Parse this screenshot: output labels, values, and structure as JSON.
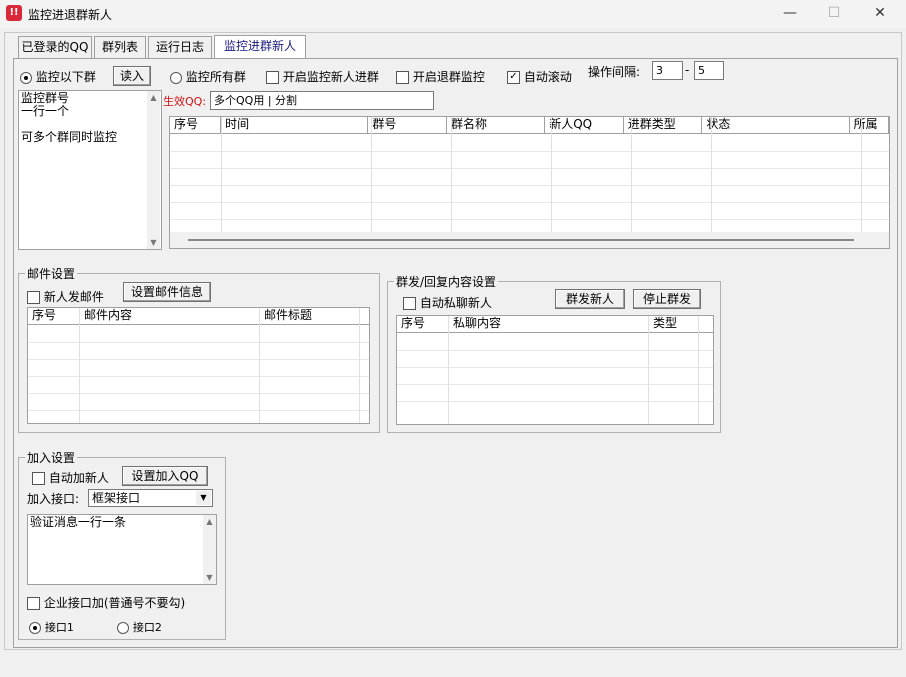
{
  "window": {
    "title": "监控进退群新人",
    "min": "—",
    "max": "☐",
    "close": "✕"
  },
  "tabs": [
    {
      "label": "已登录的QQ"
    },
    {
      "label": "群列表"
    },
    {
      "label": "运行日志"
    },
    {
      "label": "监控进群新人"
    }
  ],
  "top": {
    "monitor_following": "监控以下群",
    "read_btn": "读入",
    "monitor_all": "监控所有群",
    "enable_join": "开启监控新人进群",
    "enable_leave": "开启退群监控",
    "auto_scroll": "自动滚动",
    "interval_label": "操作间隔:",
    "interval_min": "3",
    "interval_dash": "-",
    "interval_max": "5"
  },
  "group_list": {
    "lines": [
      "监控群号",
      "一行一个",
      "",
      "可多个群同时监控"
    ]
  },
  "effective_qq": {
    "label": "生效QQ:",
    "value": "多个QQ用 | 分割"
  },
  "main_table": {
    "columns": [
      "序号",
      "时间",
      "群号",
      "群名称",
      "新人QQ",
      "进群类型",
      "状态",
      "所属"
    ]
  },
  "mail": {
    "legend": "邮件设置",
    "new_mail": "新人发邮件",
    "set_btn": "设置邮件信息",
    "columns": [
      "序号",
      "邮件内容",
      "邮件标题"
    ]
  },
  "broadcast": {
    "legend": "群发/回复内容设置",
    "auto_private": "自动私聊新人",
    "send_btn": "群发新人",
    "stop_btn": "停止群发",
    "columns": [
      "序号",
      "私聊内容",
      "类型"
    ]
  },
  "join": {
    "legend": "加入设置",
    "auto_add": "自动加新人",
    "set_btn": "设置加入QQ",
    "api_label": "加入接口:",
    "api_value": "框架接口",
    "verify_text": "验证消息一行一条",
    "enterprise": "企业接口加(普通号不要勾)",
    "api1": "接口1",
    "api2": "接口2"
  }
}
